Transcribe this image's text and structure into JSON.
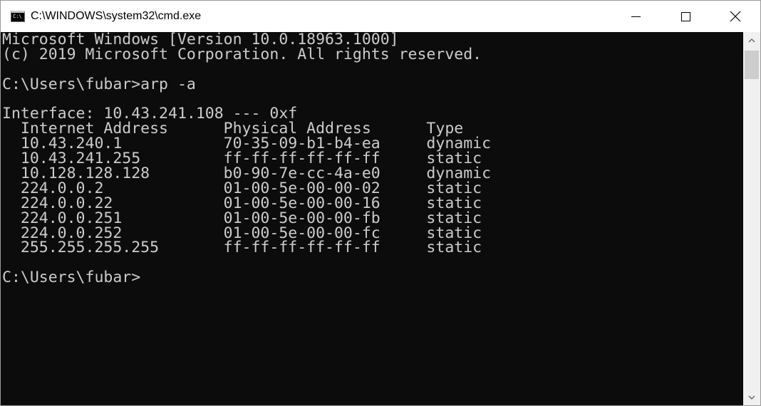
{
  "window": {
    "title": "C:\\WINDOWS\\system32\\cmd.exe",
    "icon": "console-app-icon",
    "icon_glyph": "C:\\",
    "buttons": {
      "minimize": "minimize-icon",
      "maximize": "maximize-icon",
      "close": "close-icon"
    }
  },
  "console": {
    "background": "#0c0c0c",
    "foreground": "#cccccc",
    "lines": [
      "Microsoft Windows [Version 10.0.18963.1000]",
      "(c) 2019 Microsoft Corporation. All rights reserved.",
      "",
      "C:\\Users\\fubar>arp -a",
      "",
      "Interface: 10.43.241.108 --- 0xf",
      "  Internet Address      Physical Address      Type",
      "  10.43.240.1           70-35-09-b1-b4-ea     dynamic",
      "  10.43.241.255         ff-ff-ff-ff-ff-ff     static",
      "  10.128.128.128        b0-90-7e-cc-4a-e0     dynamic",
      "  224.0.0.2             01-00-5e-00-00-02     static",
      "  224.0.0.22            01-00-5e-00-00-16     static",
      "  224.0.0.251           01-00-5e-00-00-fb     static",
      "  224.0.0.252           01-00-5e-00-00-fc     static",
      "  255.255.255.255       ff-ff-ff-ff-ff-ff     static",
      "",
      "C:\\Users\\fubar>"
    ]
  },
  "scrollbar": {
    "up_icon": "scroll-up-arrow-icon",
    "down_icon": "scroll-down-arrow-icon"
  }
}
